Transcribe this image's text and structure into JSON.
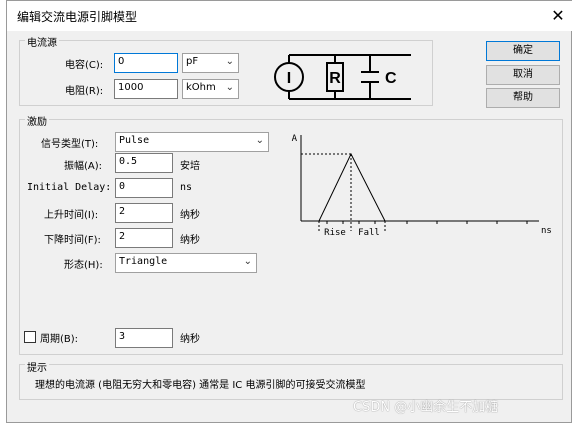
{
  "window": {
    "title": "编辑交流电源引脚模型",
    "close_glyph": "✕"
  },
  "current_source": {
    "group_label": "电流源",
    "capacitance": {
      "label": "电容(C):",
      "value": "0",
      "unit": "pF"
    },
    "resistance": {
      "label": "电阻(R):",
      "value": "1000",
      "unit": "kOhm"
    },
    "diagram": {
      "i": "I",
      "r": "R",
      "c": "C"
    }
  },
  "buttons": {
    "ok": "确定",
    "cancel": "取消",
    "help": "帮助"
  },
  "excitation": {
    "group_label": "激励",
    "signal_type": {
      "label": "信号类型(T):",
      "value": "Pulse"
    },
    "amplitude": {
      "label": "振幅(A):",
      "value": "0.5",
      "unit": "安培"
    },
    "initial_delay": {
      "label": "Initial Delay:",
      "value": "0",
      "unit": "ns"
    },
    "rise_time": {
      "label": "上升时间(I):",
      "value": "2",
      "unit": "纳秒"
    },
    "fall_time": {
      "label": "下降时间(F):",
      "value": "2",
      "unit": "纳秒"
    },
    "shape": {
      "label": "形态(H):",
      "value": "Triangle"
    },
    "period": {
      "label": "周期(B):",
      "value": "3",
      "unit": "纳秒",
      "checked": false
    },
    "waveform": {
      "y_axis": "A",
      "x_axis": "ns",
      "rise_label": "Rise",
      "fall_label": "Fall"
    }
  },
  "hint": {
    "label": "提示",
    "text": "理想的电流源 (电阻无穷大和零电容) 通常是 IC 电源引脚的可接受交流模型"
  },
  "watermark": "CSDN @小幽余生不加糖"
}
